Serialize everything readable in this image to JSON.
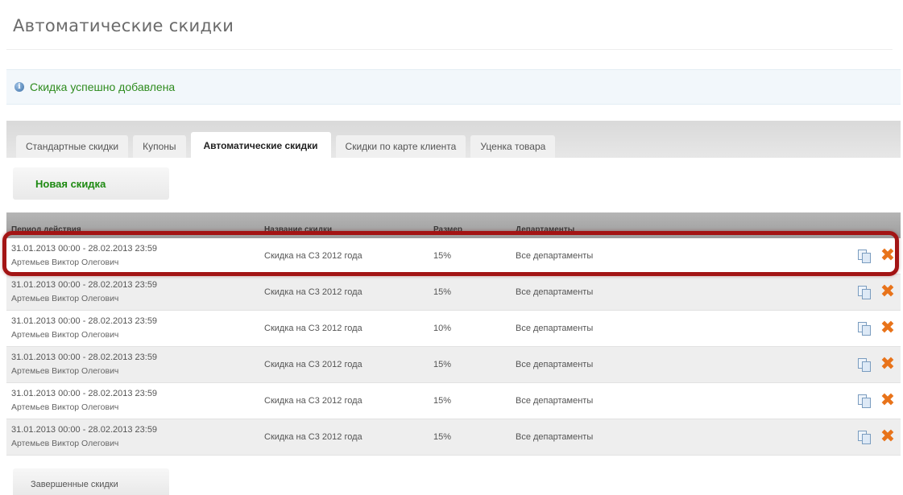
{
  "page": {
    "title": "Автоматические скидки"
  },
  "notice": {
    "icon": "info-icon",
    "text": "Скидка успешно добавлена",
    "color": "#2e8b1e"
  },
  "tabs": [
    {
      "label": "Стандартные скидки",
      "active": false
    },
    {
      "label": "Купоны",
      "active": false
    },
    {
      "label": "Автоматические скидки",
      "active": true
    },
    {
      "label": "Скидки по карте клиента",
      "active": false
    },
    {
      "label": "Уценка товара",
      "active": false
    }
  ],
  "buttons": {
    "new_discount": "Новая скидка",
    "completed_discounts": "Завершенные скидки"
  },
  "table": {
    "columns": {
      "period": "Период действия",
      "name": "Название скидки",
      "size": "Размер",
      "departments": "Департаменты"
    },
    "rows": [
      {
        "period": "31.01.2013 00:00 - 28.02.2013 23:59",
        "author": "Артемьев Виктор Олегович",
        "name": "Скидка на С3 2012 года",
        "size": "15%",
        "departments": "Все департаменты"
      },
      {
        "period": "31.01.2013 00:00 - 28.02.2013 23:59",
        "author": "Артемьев Виктор Олегович",
        "name": "Скидка на С3 2012 года",
        "size": "15%",
        "departments": "Все департаменты"
      },
      {
        "period": "31.01.2013 00:00 - 28.02.2013 23:59",
        "author": "Артемьев Виктор Олегович",
        "name": "Скидка на С3 2012 года",
        "size": "10%",
        "departments": "Все департаменты"
      },
      {
        "period": "31.01.2013 00:00 - 28.02.2013 23:59",
        "author": "Артемьев Виктор Олегович",
        "name": "Скидка на С3 2012 года",
        "size": "15%",
        "departments": "Все департаменты"
      },
      {
        "period": "31.01.2013 00:00 - 28.02.2013 23:59",
        "author": "Артемьев Виктор Олегович",
        "name": "Скидка на С3 2012 года",
        "size": "15%",
        "departments": "Все департаменты"
      },
      {
        "period": "31.01.2013 00:00 - 28.02.2013 23:59",
        "author": "Артемьев Виктор Олегович",
        "name": "Скидка на С3 2012 года",
        "size": "15%",
        "departments": "Все департаменты"
      }
    ],
    "row_actions": {
      "copy_icon": "copy-icon",
      "delete_icon": "delete-icon",
      "delete_color": "#e8731a"
    }
  },
  "annotation": {
    "highlight_color": "#a31414"
  }
}
